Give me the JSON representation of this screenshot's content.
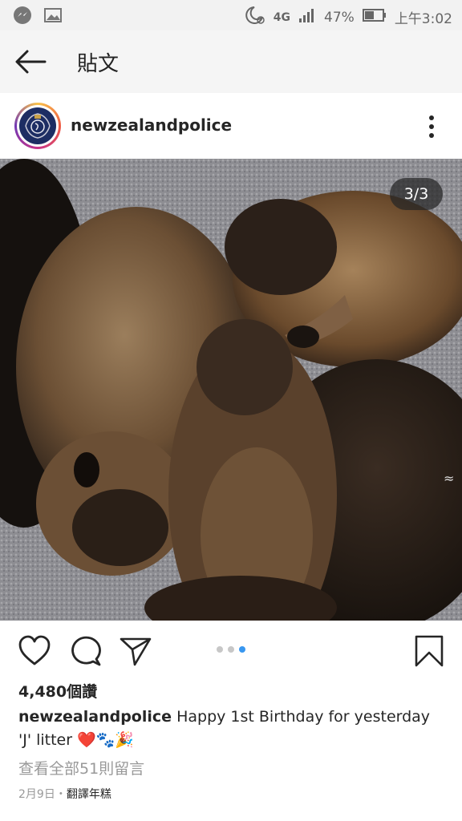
{
  "status_bar": {
    "network": "4G",
    "battery": "47%",
    "time": "上午3:02",
    "icons": [
      "messenger-icon",
      "gallery-icon",
      "moon-alarm-icon",
      "signal-icon",
      "battery-icon"
    ]
  },
  "nav": {
    "title": "貼文",
    "back_icon": "back-arrow-icon"
  },
  "post": {
    "username": "newzealandpolice",
    "photo_counter": "3/3",
    "carousel": {
      "total": 3,
      "active": 3
    },
    "likes": "4,480個讚",
    "caption_user": "newzealandpolice",
    "caption_text": "Happy 1st Birthday for yesterday 'J' litter ❤️🐾🎉",
    "view_comments": "查看全部51則留言",
    "date": "2月9日",
    "separator": "・",
    "translate": "翻譯年糕"
  },
  "colors": {
    "accent": "#3897f0",
    "text": "#262626",
    "muted": "#999999",
    "heart": "#e8457a"
  }
}
